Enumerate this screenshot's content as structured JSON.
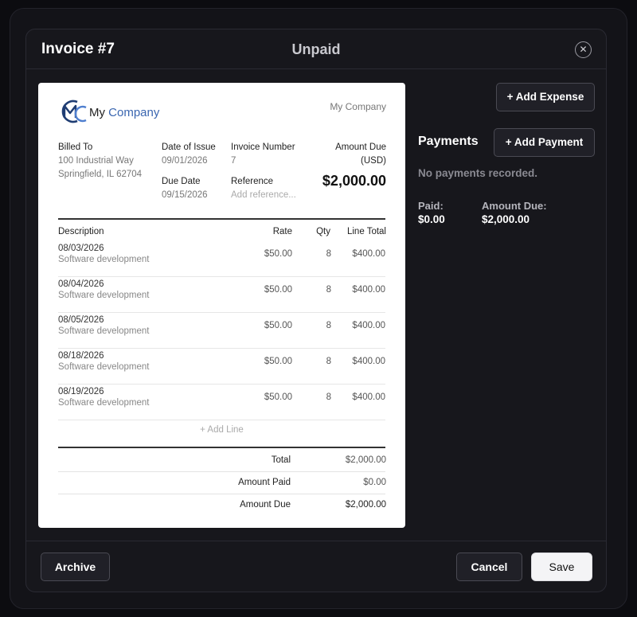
{
  "modal": {
    "title": "Invoice #7",
    "status": "Unpaid",
    "close_icon": "close-icon"
  },
  "invoice": {
    "logo_text_1": "My ",
    "logo_text_2": "Company",
    "company_name": "My Company",
    "billed_to_label": "Billed To",
    "billed_to_line1": "100 Industrial Way",
    "billed_to_line2": "Springfield, IL 62704",
    "date_of_issue_label": "Date of Issue",
    "date_of_issue": "09/01/2026",
    "due_date_label": "Due Date",
    "due_date": "09/15/2026",
    "invoice_number_label": "Invoice Number",
    "invoice_number": "7",
    "reference_label": "Reference",
    "reference_placeholder": "Add reference...",
    "amount_due_label": "Amount Due",
    "amount_due_currency": "(USD)",
    "amount_due_big": "$2,000.00",
    "columns": {
      "description": "Description",
      "rate": "Rate",
      "qty": "Qty",
      "line_total": "Line Total"
    },
    "lines": [
      {
        "date": "08/03/2026",
        "description": "Software development",
        "rate": "$50.00",
        "qty": "8",
        "total": "$400.00"
      },
      {
        "date": "08/04/2026",
        "description": "Software development",
        "rate": "$50.00",
        "qty": "8",
        "total": "$400.00"
      },
      {
        "date": "08/05/2026",
        "description": "Software development",
        "rate": "$50.00",
        "qty": "8",
        "total": "$400.00"
      },
      {
        "date": "08/18/2026",
        "description": "Software development",
        "rate": "$50.00",
        "qty": "8",
        "total": "$400.00"
      },
      {
        "date": "08/19/2026",
        "description": "Software development",
        "rate": "$50.00",
        "qty": "8",
        "total": "$400.00"
      }
    ],
    "add_line": "+ Add Line",
    "summary": {
      "total_label": "Total",
      "total": "$2,000.00",
      "amount_paid_label": "Amount Paid",
      "amount_paid": "$0.00",
      "amount_due_label": "Amount Due",
      "amount_due": "$2,000.00"
    }
  },
  "side": {
    "add_expense": "+ Add Expense",
    "payments_title": "Payments",
    "add_payment": "+ Add Payment",
    "no_payments": "No payments recorded.",
    "paid_label": "Paid:",
    "paid_value": "$0.00",
    "amount_due_label": "Amount Due:",
    "amount_due_value": "$2,000.00"
  },
  "footer": {
    "archive": "Archive",
    "cancel": "Cancel",
    "save": "Save"
  },
  "colors": {
    "accent": "#3a66b0",
    "background": "#0c0c10",
    "panel": "#17171c"
  }
}
